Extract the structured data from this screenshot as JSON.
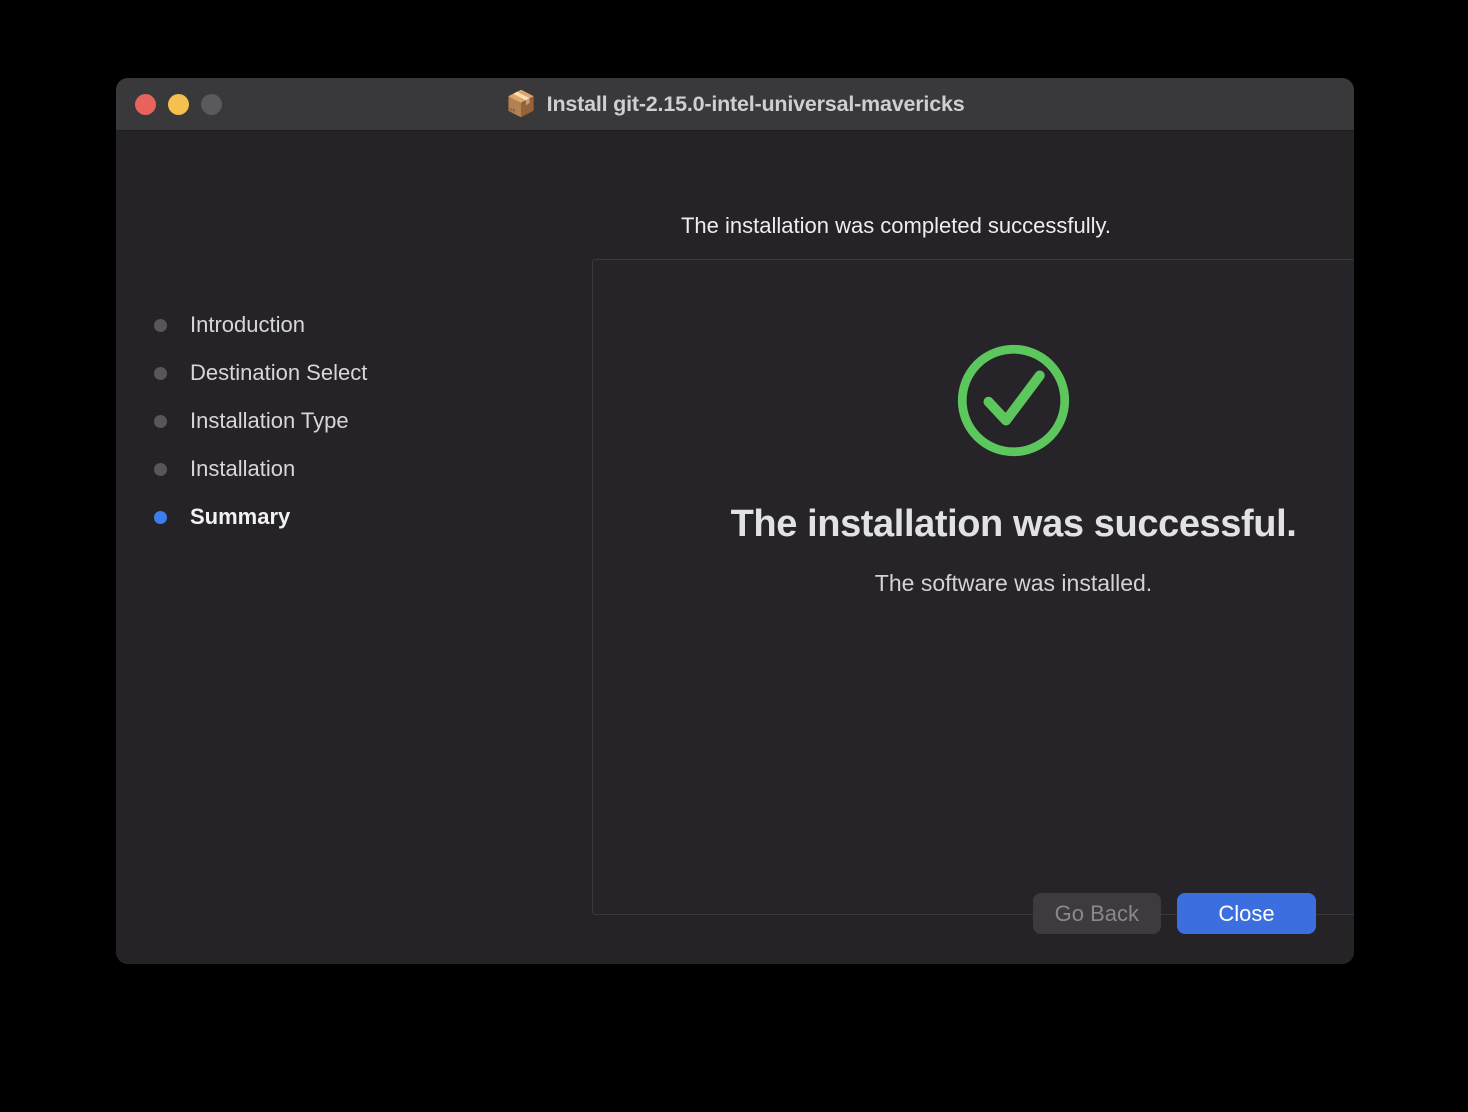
{
  "window": {
    "title": "Install git-2.15.0-intel-universal-mavericks",
    "package_icon": "📦",
    "traffic_lights": {
      "close_label": "close-window",
      "minimize_label": "minimize-window",
      "zoom_label": "zoom-window"
    }
  },
  "sidebar": {
    "steps": [
      {
        "label": "Introduction",
        "state": "done"
      },
      {
        "label": "Destination Select",
        "state": "done"
      },
      {
        "label": "Installation Type",
        "state": "done"
      },
      {
        "label": "Installation",
        "state": "done"
      },
      {
        "label": "Summary",
        "state": "current"
      }
    ]
  },
  "main": {
    "heading": "The installation was completed successfully.",
    "success_icon": "check-circle",
    "success_title": "The installation was successful.",
    "success_subtitle": "The software was installed."
  },
  "footer": {
    "go_back_label": "Go Back",
    "close_label": "Close"
  },
  "colors": {
    "window_background": "#262327",
    "titlebar_background": "#39383A",
    "content_box_background": "#272429",
    "content_box_border": "#3B383E",
    "accent_blue": "#3B6FE0",
    "step_active_blue": "#3B7EF0",
    "step_inactive_gray": "#58565A",
    "success_green": "#5CC75C",
    "traffic_close_red": "#E8635C",
    "traffic_minimize_yellow": "#F4C04F",
    "traffic_zoom_gray": "#5A5A5C",
    "disabled_button_background": "#3E3B40",
    "disabled_button_text": "#8B888D"
  }
}
